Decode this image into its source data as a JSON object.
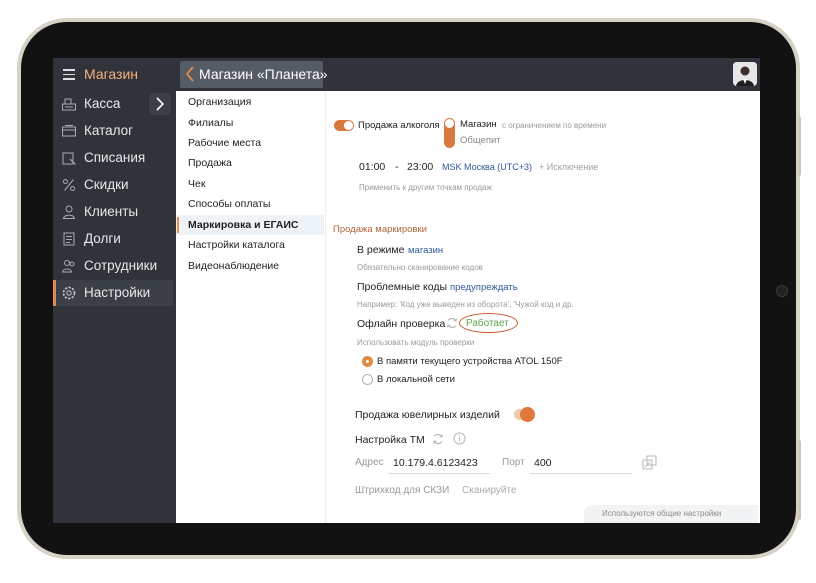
{
  "app": {
    "title": "Магазин",
    "page_title": "Магазин «Планета»"
  },
  "sidebar": {
    "items": [
      {
        "label": "Касса",
        "icon": "cash-register-icon"
      },
      {
        "label": "Каталог",
        "icon": "catalog-icon"
      },
      {
        "label": "Списания",
        "icon": "write-off-icon"
      },
      {
        "label": "Скидки",
        "icon": "percent-icon"
      },
      {
        "label": "Клиенты",
        "icon": "clients-icon"
      },
      {
        "label": "Долги",
        "icon": "debts-icon"
      },
      {
        "label": "Сотрудники",
        "icon": "employees-icon"
      },
      {
        "label": "Настройки",
        "icon": "gear-icon"
      }
    ],
    "active": "Настройки"
  },
  "submenu": {
    "items": [
      "Организация",
      "Филиалы",
      "Рабочие места",
      "Продажа",
      "Чек",
      "Способы оплаты",
      "Маркировка и ЕГАИС",
      "Настройки каталога",
      "Видеонаблюдение"
    ],
    "active": "Маркировка и ЕГАИС"
  },
  "alcohol": {
    "label": "Продажа алкоголя",
    "enabled": true,
    "mode_shop": "Магазин",
    "mode_shop_note": "с ограничением по времени",
    "mode_catering": "Общепит",
    "time_from": "01:00",
    "time_sep": "-",
    "time_to": "23:00",
    "timezone": "MSK Москва (UTC+3)",
    "exception": "+ Исключение",
    "apply_others": "Применить к другим точкам продаж"
  },
  "marking": {
    "section_title": "Продажа маркировки",
    "mode_label": "В режиме",
    "mode_value": "магазин",
    "mode_note": "Обязательно сканирование кодов",
    "problem_label": "Проблемные коды",
    "problem_value": "предупреждать",
    "problem_note": "Например: 'Код уже выведен из оборота', 'Чужой код и др.",
    "offline_label": "Офлайн проверка",
    "offline_status": "Работает",
    "module_note": "Использовать модуль проверки",
    "option_device": "В памяти текущего устройства ATOL 150F",
    "option_network": "В локальной сети",
    "selected_option": "В памяти текущего устройства ATOL 150F"
  },
  "jewelry": {
    "label": "Продажа ювелирных изделий",
    "enabled": true
  },
  "tm": {
    "label": "Настройка ТМ",
    "address_label": "Адрес",
    "address_value": "10.179.4.6123423",
    "port_label": "Порт",
    "port_value": "400",
    "barcode_label": "Штрихкод для СКЗИ",
    "barcode_placeholder": "Сканируйте"
  },
  "footer": {
    "note": "Используются общие настройки"
  },
  "colors": {
    "accent": "#e58a4a",
    "sidebar_bg": "#30343a",
    "link": "#2e5b9a",
    "status_ok": "#5aa64a"
  }
}
